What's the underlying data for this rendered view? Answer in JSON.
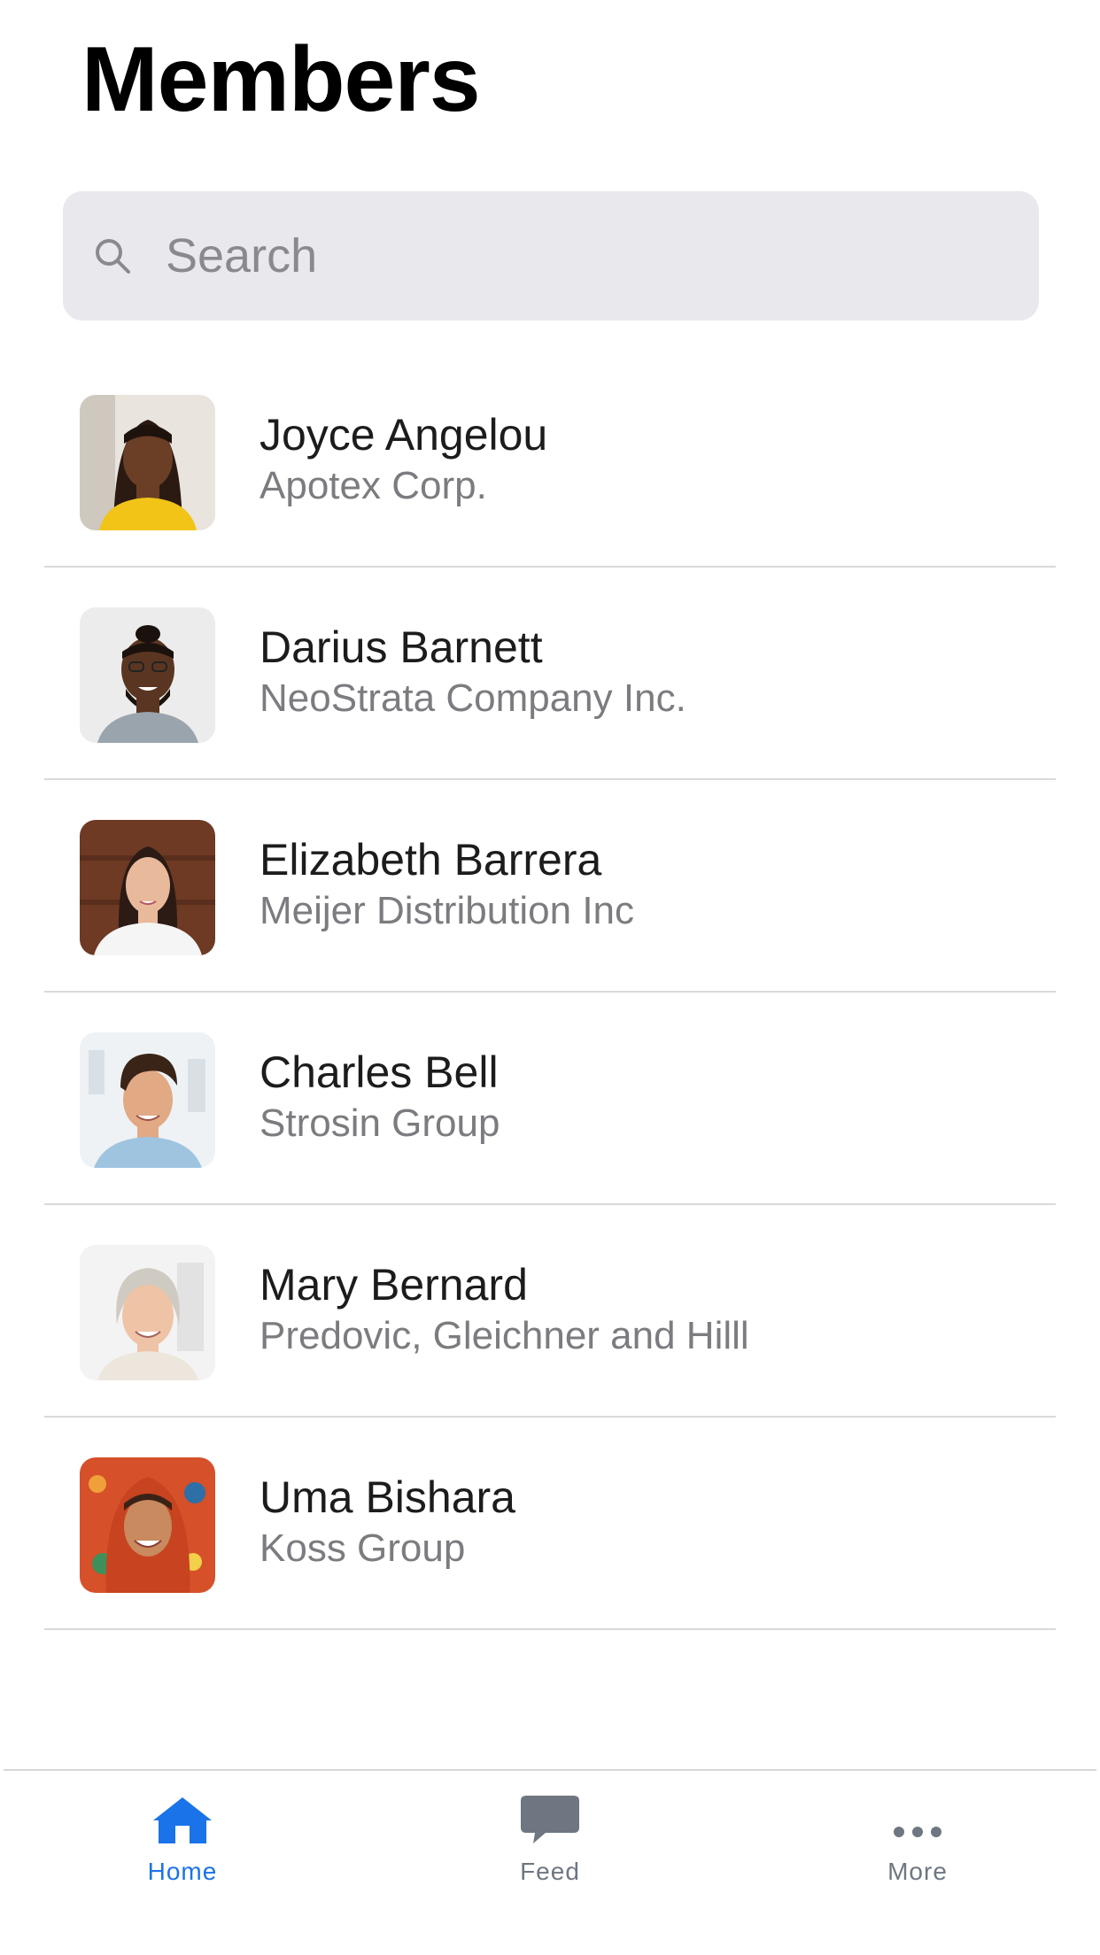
{
  "page": {
    "title": "Members"
  },
  "search": {
    "placeholder": "Search",
    "value": ""
  },
  "members": [
    {
      "name": "Joyce Angelou",
      "company": "Apotex Corp."
    },
    {
      "name": "Darius Barnett",
      "company": "NeoStrata Company Inc."
    },
    {
      "name": "Elizabeth Barrera",
      "company": "Meijer Distribution Inc"
    },
    {
      "name": "Charles Bell",
      "company": "Strosin Group"
    },
    {
      "name": "Mary Bernard",
      "company": "Predovic, Gleichner and Hilll"
    },
    {
      "name": "Uma Bishara",
      "company": "Koss Group"
    }
  ],
  "tabbar": {
    "home": {
      "label": "Home",
      "icon": "house-icon",
      "active": true
    },
    "feed": {
      "label": "Feed",
      "icon": "chat-bubble-icon",
      "active": false
    },
    "more": {
      "label": "More",
      "icon": "ellipsis-icon",
      "active": false
    }
  },
  "colors": {
    "accent": "#1a73e8",
    "inactive": "#6e7781",
    "search_bg": "#e8e8ed",
    "divider": "#d9d9dc",
    "secondary_text": "#7c7c80"
  }
}
